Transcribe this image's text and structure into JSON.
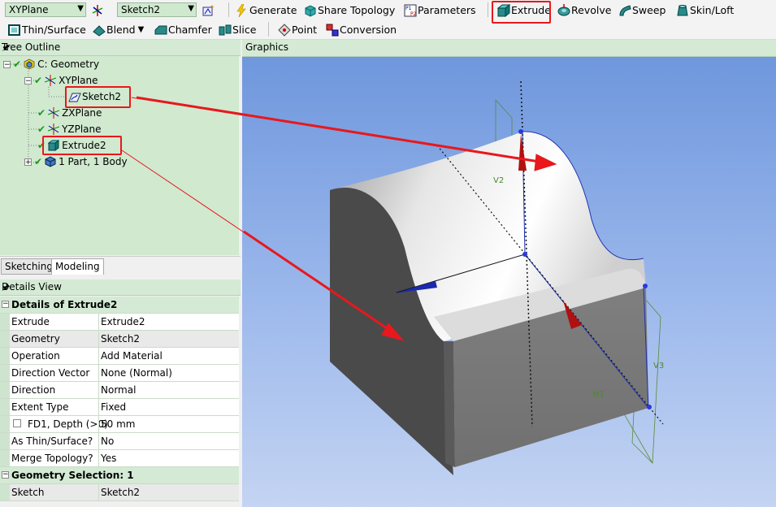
{
  "toolbar1": {
    "plane_combo": "XYPlane",
    "sketch_combo": "Sketch2",
    "generate": "Generate",
    "share_topology": "Share Topology",
    "parameters": "Parameters",
    "extrude": "Extrude",
    "revolve": "Revolve",
    "sweep": "Sweep",
    "skin_loft": "Skin/Loft"
  },
  "toolbar2": {
    "thin_surface": "Thin/Surface",
    "blend": "Blend",
    "chamfer": "Chamfer",
    "slice": "Slice",
    "point": "Point",
    "conversion": "Conversion"
  },
  "tree": {
    "header": "Tree Outline",
    "pin": "░",
    "nodes": [
      {
        "label": "C: Geometry"
      },
      {
        "label": "XYPlane"
      },
      {
        "label": "Sketch2"
      },
      {
        "label": "ZXPlane"
      },
      {
        "label": "YZPlane"
      },
      {
        "label": "Extrude2"
      },
      {
        "label": "1 Part, 1 Body"
      }
    ]
  },
  "tabs": {
    "sketching": "Sketching",
    "modeling": "Modeling"
  },
  "details": {
    "header": "Details View",
    "section1": "Details of Extrude2",
    "rows": [
      {
        "k": "Extrude",
        "v": "Extrude2"
      },
      {
        "k": "Geometry",
        "v": "Sketch2"
      },
      {
        "k": "Operation",
        "v": "Add Material"
      },
      {
        "k": "Direction Vector",
        "v": "None (Normal)"
      },
      {
        "k": "Direction",
        "v": "Normal"
      },
      {
        "k": "Extent Type",
        "v": "Fixed"
      },
      {
        "k": "FD1,  Depth (>0)",
        "v": "50 mm"
      },
      {
        "k": "As Thin/Surface?",
        "v": "No"
      },
      {
        "k": "Merge Topology?",
        "v": "Yes"
      }
    ],
    "section2": "Geometry Selection: 1",
    "rows2": [
      {
        "k": "Sketch",
        "v": "Sketch2"
      }
    ]
  },
  "graphics": {
    "header": "Graphics",
    "dim_v2": "V2",
    "dim_v3": "V3",
    "dim_h1": "H1"
  },
  "colors": {
    "highlight": "#e8181c",
    "tree_bg": "#d0e9cf",
    "viewport_top": "#6f97dd",
    "viewport_bottom": "#c4d4f2"
  }
}
